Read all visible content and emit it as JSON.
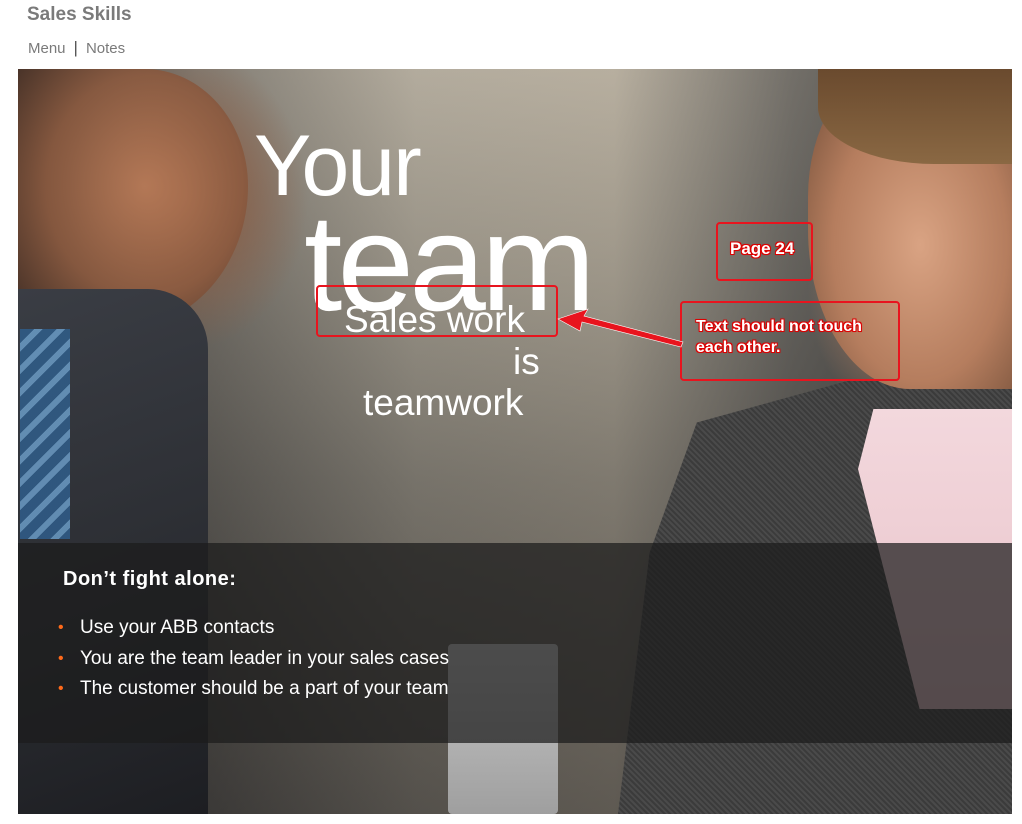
{
  "app": {
    "title": "Sales Skills"
  },
  "nav": {
    "menu": "Menu",
    "separator": "|",
    "notes": "Notes"
  },
  "slide": {
    "headline": {
      "line1": "Your",
      "line2": "team"
    },
    "tagline": {
      "line1": "Sales work",
      "line2": "is",
      "line3": "teamwork"
    },
    "panel": {
      "heading": "Don’t fight alone:",
      "bullets": [
        "Use your ABB contacts",
        "You are the team leader in your sales cases",
        "The customer should be a part of your team"
      ],
      "bullet_symbol": "•"
    }
  },
  "annotations": {
    "page_label": "Page 24",
    "comment_line1": "Text should not touch",
    "comment_line2": "each other."
  },
  "colors": {
    "annotation_red": "#e8141e",
    "bullet_orange": "#ff6a1a",
    "title_gray": "#7a7a7a"
  }
}
